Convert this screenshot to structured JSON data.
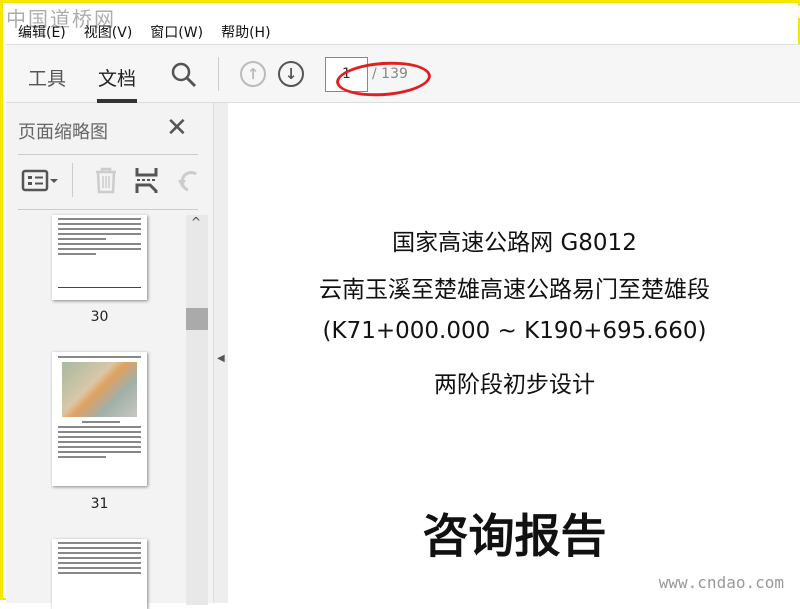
{
  "watermark_top": "中国道桥网",
  "watermark_bottom": "www.cndao.com",
  "menu": [
    "编辑(E)",
    "视图(V)",
    "窗口(W)",
    "帮助(H)"
  ],
  "toolbar": {
    "tools_tab": "工具",
    "document_tab": "文档",
    "current_page": "1",
    "total_pages": "/ 139"
  },
  "sidebar": {
    "title": "页面缩略图",
    "thumbnails": [
      {
        "label": "30"
      },
      {
        "label": "31"
      }
    ]
  },
  "document": {
    "lines": [
      "国家高速公路网 G8012",
      "云南玉溪至楚雄高速公路易门至楚雄段",
      "(K71+000.000 ~ K190+695.660)",
      "两阶段初步设计"
    ],
    "report_title": "咨询报告"
  },
  "colors": {
    "highlight": "#e02020",
    "border": "#f5e800"
  }
}
